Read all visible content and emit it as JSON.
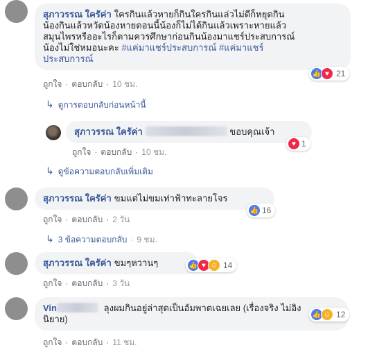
{
  "comments": [
    {
      "author": "สุภาวรรณ ใครัค่า",
      "text_lines": [
        "ใครกินแล้วหายก็กินใครกินแล่วไม่ดีก็หยุดกิน",
        "น้องกินแล้วหวัดน้องหายตอนนี้น้องก็ไม่ได้กินแล้วเพราะหายแล้ว",
        "สมุนไพรหรืออะไรก็ตามควรศึกษาก่อนกินน้องมาแชร์ประสบการณ์",
        "น้องไม่ใช่หมอนะคะ"
      ],
      "hashtag1": "#แค่มาแชร์ประสบการณ์",
      "hashtag2_part1": "#แค่มาแชร์",
      "hashtag2_part2": "ประสบการณ์",
      "like_label": "ถูกใจ",
      "reply_label": "ตอบกลับ",
      "time": "10 ชม.",
      "reaction_count": "21",
      "view_previous": "ดูการตอบกลับก่อนหน้านี้"
    },
    {
      "author": "สุภาวรรณ ใครัค่า",
      "text": "ขอบคุณเจ้า",
      "like_label": "ถูกใจ",
      "reply_label": "ตอบกลับ",
      "time": "10 ชม.",
      "reaction_count": "1",
      "view_more": "ดูข้อความตอบกลับเพิ่มเติม"
    },
    {
      "author": "สุภาวรรณ ใครัค่า",
      "text": "ขมแต่ไม่ขมเท่าฟ้าทะลายโจร",
      "like_label": "ถูกใจ",
      "reply_label": "ตอบกลับ",
      "time": "2 วัน",
      "reaction_count": "16",
      "replies_label": "3 ข้อความตอบกลับ",
      "replies_time": "9 ชม."
    },
    {
      "author": "สุภาวรรณ ใครัค่า",
      "text": "ขมๆหวานๆ",
      "like_label": "ถูกใจ",
      "reply_label": "ตอบกลับ",
      "time": "3 วัน",
      "reaction_count": "14"
    },
    {
      "author": "Vin",
      "text_line1": "ลุงผมกินอยู่ล่าสุดเป็นอัมพาตเฉยเลย (เรื่องจริง ไม่อิง",
      "text_line2": "นิยาย)",
      "like_label": "ถูกใจ",
      "reply_label": "ตอบกลับ",
      "time": "11 ชม.",
      "reaction_count": "12"
    }
  ],
  "separator": "·",
  "colors": {
    "name": "#385898",
    "bubble": "#f2f3f5",
    "meta": "#616770",
    "like": "#4a7bf4",
    "love": "#f0284a",
    "haha": "#f7b125"
  }
}
